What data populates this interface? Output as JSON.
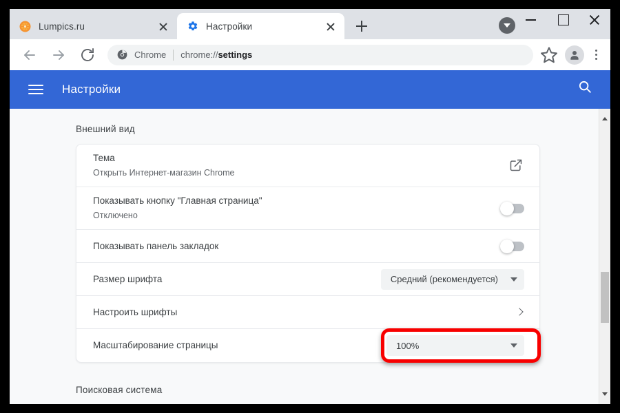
{
  "window": {
    "controls": {
      "minimize": "minimize-window",
      "maximize": "maximize-window",
      "close": "close-window"
    }
  },
  "tabstrip": {
    "tabs": [
      {
        "title": "Lumpics.ru",
        "favicon": "orange-circle-favicon",
        "active": false,
        "close_label": "close-tab"
      },
      {
        "title": "Настройки",
        "favicon": "gear-icon",
        "active": true,
        "close_label": "close-tab"
      }
    ],
    "new_tab_label": "+",
    "download_indicator": "download-icon"
  },
  "toolbar": {
    "back": "back-arrow",
    "forward": "forward-arrow",
    "reload": "reload-icon",
    "omnibox": {
      "site_icon": "chrome-icon",
      "scheme_label": "Chrome",
      "url_prefix": "chrome://",
      "url_bold": "settings"
    },
    "bookmark": "star-icon",
    "profile": "avatar-icon",
    "menu": "three-dot-menu"
  },
  "settings_header": {
    "menu_icon": "hamburger-icon",
    "title": "Настройки",
    "search_icon": "search-icon",
    "accent_color": "#3367d6"
  },
  "content": {
    "sections": [
      {
        "title": "Внешний вид"
      },
      {
        "title": "Поисковая система"
      }
    ],
    "appearance_rows": [
      {
        "label": "Тема",
        "sublabel": "Открыть Интернет-магазин Chrome",
        "control": "external-link-icon"
      },
      {
        "label": "Показывать кнопку \"Главная страница\"",
        "sublabel": "Отключено",
        "control": "toggle",
        "toggle_on": false
      },
      {
        "label": "Показывать панель закладок",
        "sublabel": "",
        "control": "toggle",
        "toggle_on": false
      },
      {
        "label": "Размер шрифта",
        "sublabel": "",
        "control": "select",
        "value": "Средний (рекомендуется)"
      },
      {
        "label": "Настроить шрифты",
        "sublabel": "",
        "control": "chevron"
      },
      {
        "label": "Масштабирование страницы",
        "sublabel": "",
        "control": "select",
        "value": "100%"
      }
    ]
  },
  "scrollbar": {
    "up_arrow": "scroll-up-arrow",
    "down_arrow": "scroll-down-arrow",
    "thumb": "scroll-thumb"
  },
  "annotation": {
    "highlight_color": "#f80000",
    "target": "page-zoom-select"
  }
}
